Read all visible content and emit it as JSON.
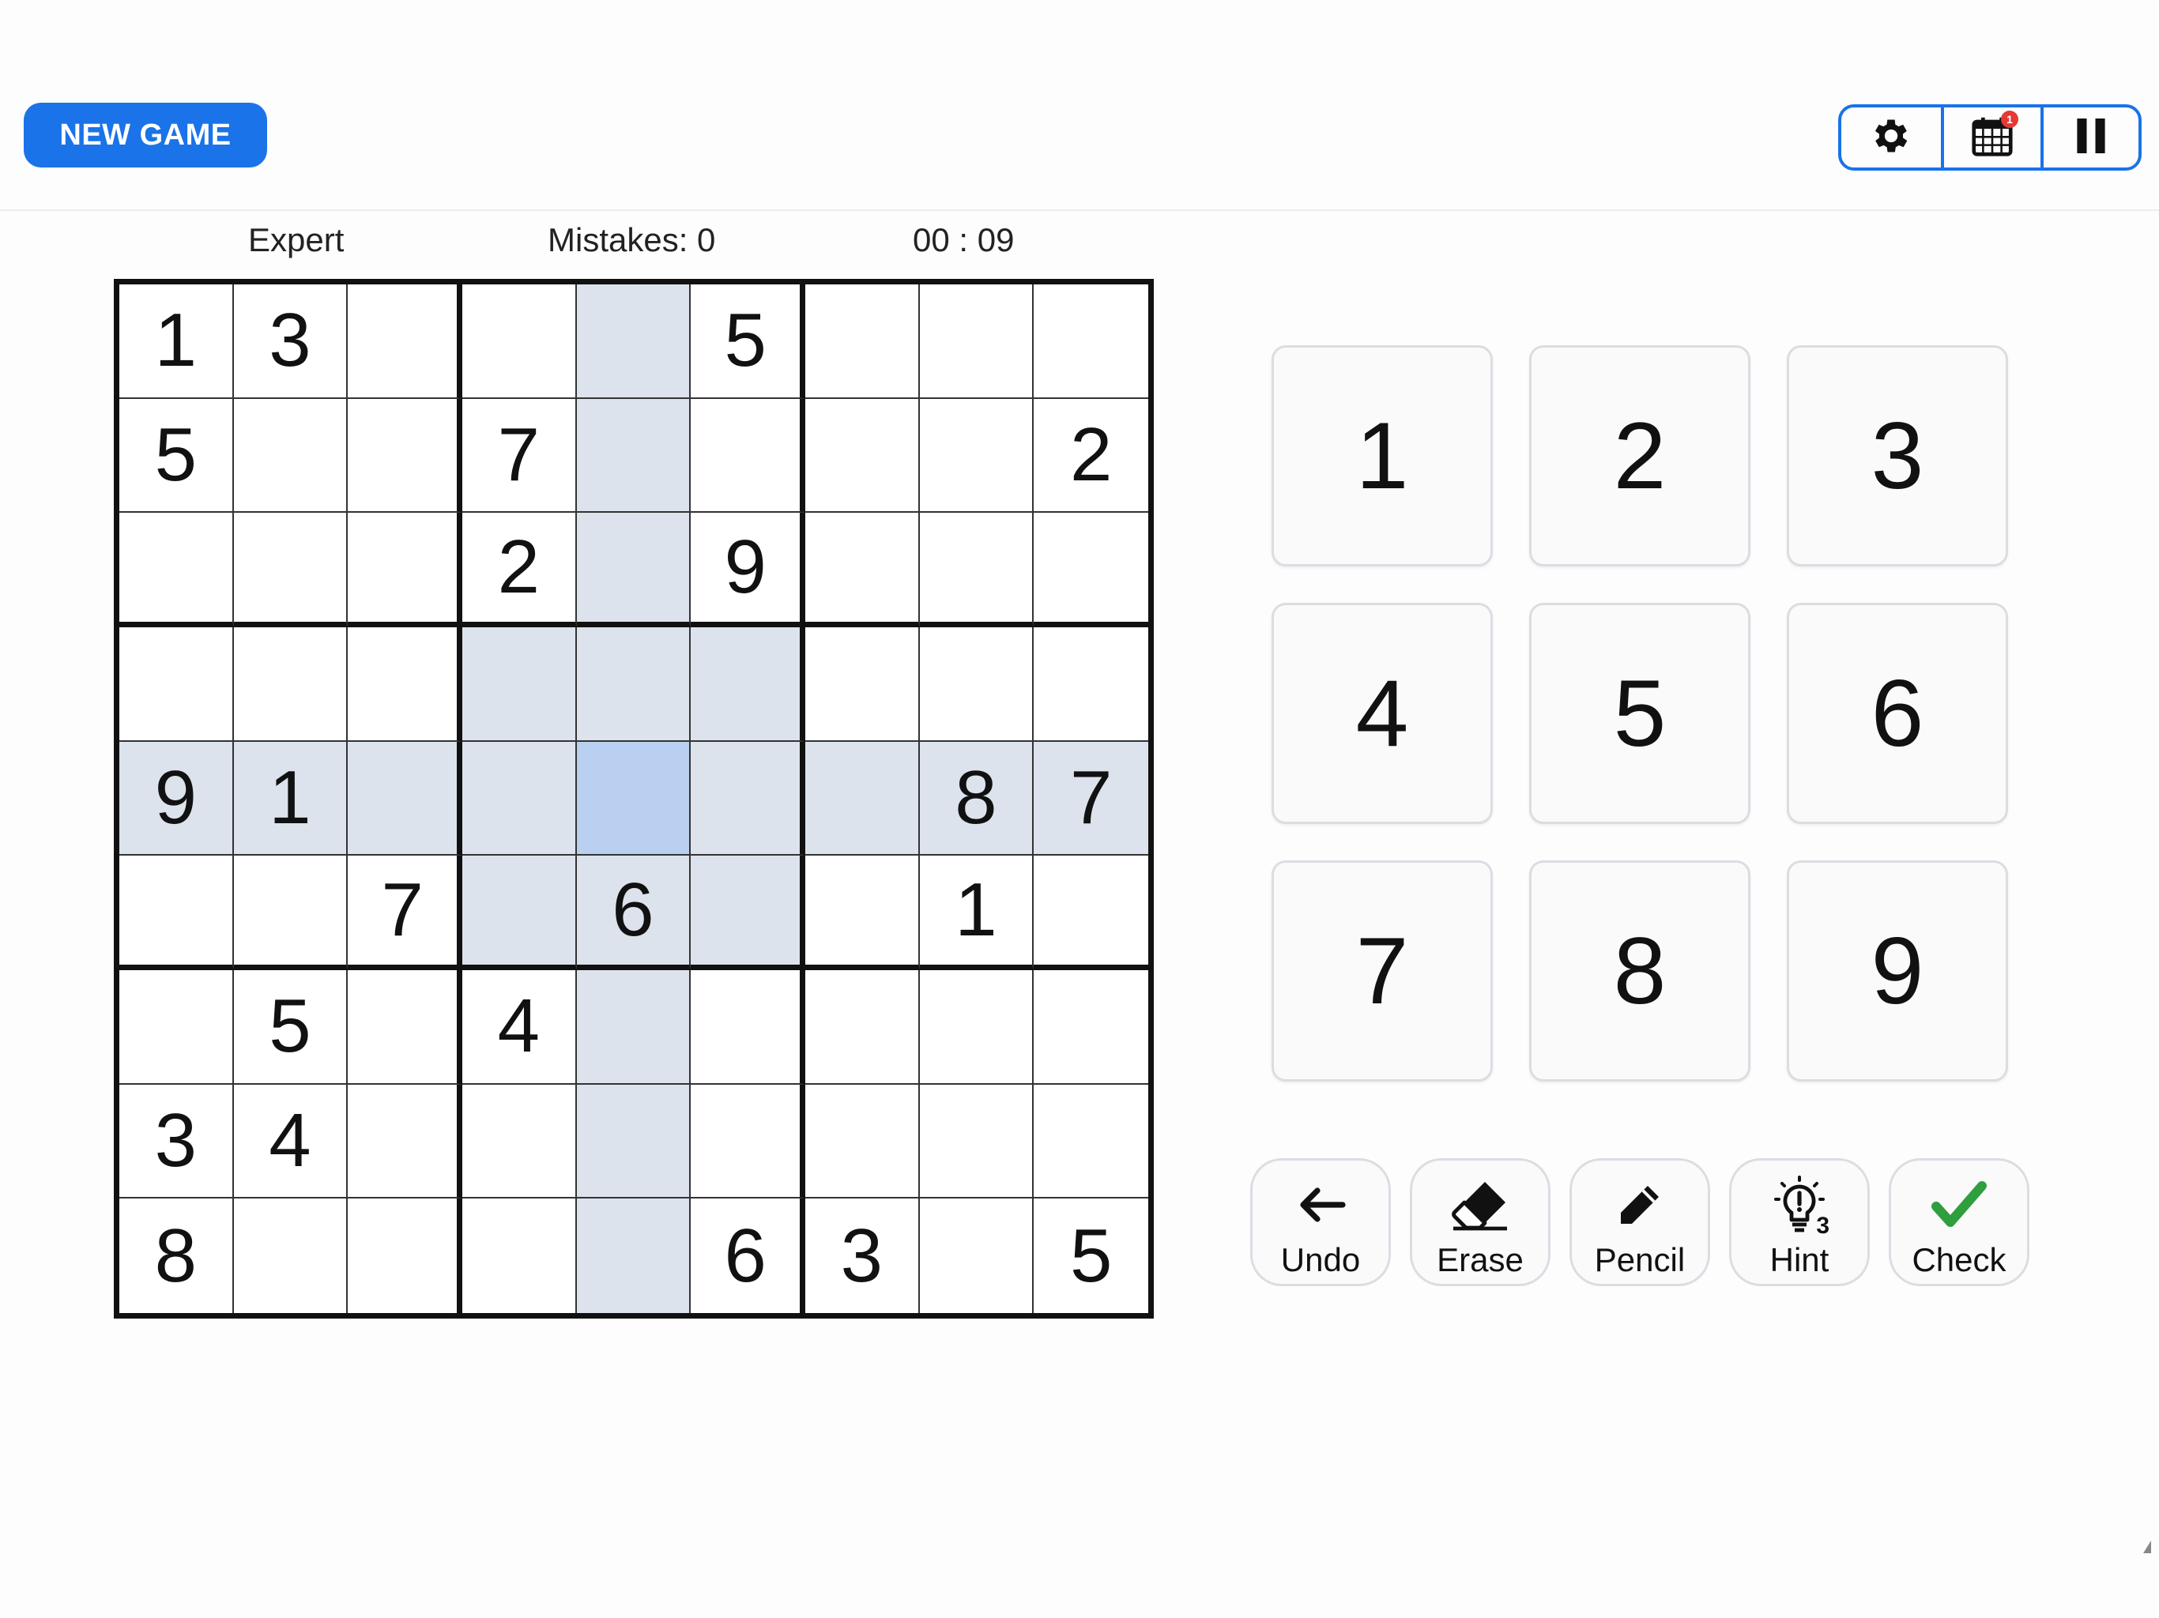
{
  "header": {
    "new_game_label": "NEW GAME",
    "icons": [
      "gear-icon",
      "calendar-icon",
      "pause-icon"
    ],
    "calendar_badge": "1"
  },
  "status": {
    "difficulty": "Expert",
    "mistakes": "Mistakes: 0",
    "timer": "00 : 09"
  },
  "board": {
    "selected": {
      "row": 4,
      "col": 4
    },
    "highlight_color": "#dce3ed",
    "selected_color": "#b9d0f0",
    "rows": [
      [
        "1",
        "3",
        "",
        "",
        "",
        "5",
        "",
        "",
        ""
      ],
      [
        "5",
        "",
        "",
        "7",
        "",
        "",
        "",
        "",
        "2"
      ],
      [
        "",
        "",
        "",
        "2",
        "",
        "9",
        "",
        "",
        ""
      ],
      [
        "",
        "",
        "",
        "",
        "",
        "",
        "",
        "",
        ""
      ],
      [
        "9",
        "1",
        "",
        "",
        "",
        "",
        "",
        "8",
        "7"
      ],
      [
        "",
        "",
        "7",
        "",
        "6",
        "",
        "",
        "1",
        ""
      ],
      [
        "",
        "5",
        "",
        "4",
        "",
        "",
        "",
        "",
        ""
      ],
      [
        "3",
        "4",
        "",
        "",
        "",
        "",
        "",
        "",
        ""
      ],
      [
        "8",
        "",
        "",
        "",
        "",
        "6",
        "3",
        "",
        "5"
      ]
    ]
  },
  "numpad": {
    "keys": [
      "1",
      "2",
      "3",
      "4",
      "5",
      "6",
      "7",
      "8",
      "9"
    ]
  },
  "actions": {
    "undo": "Undo",
    "erase": "Erase",
    "pencil": "Pencil",
    "hint": "Hint",
    "hint_count": "3",
    "check": "Check"
  },
  "colors": {
    "accent": "#1a73e8",
    "check_green": "#2e9e3e",
    "badge_red": "#e53935"
  }
}
